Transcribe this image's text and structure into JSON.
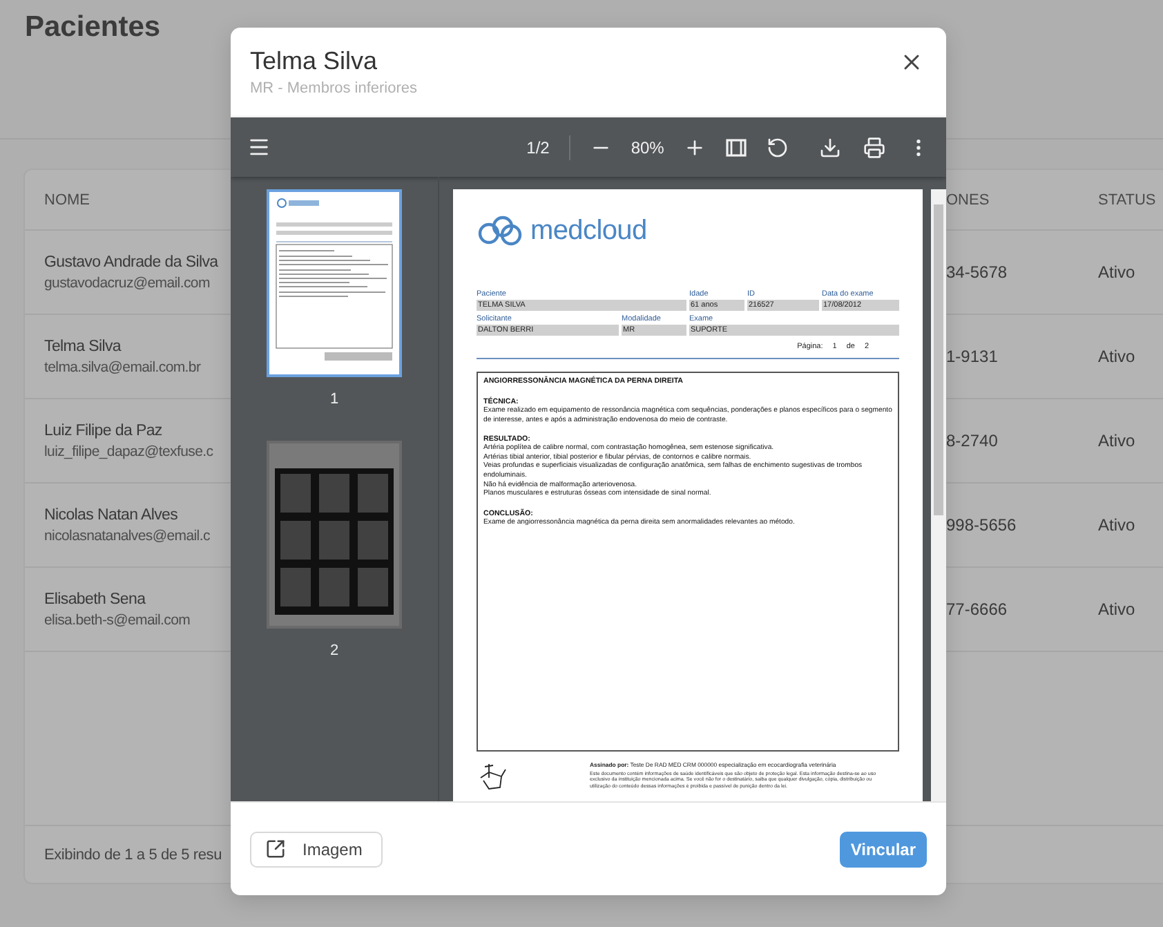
{
  "page": {
    "title": "Pacientes"
  },
  "table": {
    "columns": [
      "NOME",
      "ONES",
      "STATUS"
    ],
    "rows": [
      {
        "name": "Gustavo Andrade da Silva",
        "email": "gustavodacruz@email.com",
        "phone": "34-5678",
        "status": "Ativo"
      },
      {
        "name": "Telma Silva",
        "email": "telma.silva@email.com.br",
        "phone": "1-9131",
        "status": "Ativo"
      },
      {
        "name": "Luiz Filipe da Paz",
        "email": "luiz_filipe_dapaz@texfuse.c",
        "phone": "8-2740",
        "status": "Ativo"
      },
      {
        "name": "Nicolas Natan Alves",
        "email": "nicolasnatanalves@email.c",
        "phone": "998-5656",
        "status": "Ativo"
      },
      {
        "name": "Elisabeth Sena",
        "email": "elisa.beth-s@email.com",
        "phone": "77-6666",
        "status": "Ativo"
      }
    ],
    "footer": "Exibindo de 1 a 5 de 5 resu"
  },
  "modal": {
    "title": "Telma Silva",
    "subtitle": "MR - Membros inferiores",
    "viewer": {
      "page_indicator": "1/2",
      "zoom": "80%",
      "thumbnails": [
        {
          "label": "1",
          "kind": "report",
          "selected": true
        },
        {
          "label": "2",
          "kind": "images",
          "selected": false
        }
      ],
      "document": {
        "logo": "medcloud",
        "field_rows": [
          [
            {
              "label": "Paciente",
              "value": "TELMA SILVA"
            },
            {
              "label": "Idade",
              "value": "61 anos"
            },
            {
              "label": "ID",
              "value": "216527"
            },
            {
              "label": "Data do exame",
              "value": "17/08/2012"
            }
          ],
          [
            {
              "label": "Solicitante",
              "value": "DALTON BERRI"
            },
            {
              "label": "Modalidade",
              "value": "MR"
            },
            {
              "label": "Exame",
              "value": "SUPORTE"
            }
          ]
        ],
        "page_label": "Página:",
        "page_number": "1",
        "page_of": "de",
        "page_total": "2",
        "report_title": "ANGIORRESSONÂNCIA MAGNÉTICA DA PERNA DIREITA",
        "sections": [
          {
            "heading": "TÉCNICA:",
            "lines": [
              "Exame realizado em equipamento de ressonância magnética com sequências, ponderações e planos específicos para o segmento de interesse, antes e após a administração endovenosa do meio de contraste."
            ]
          },
          {
            "heading": "RESULTADO:",
            "lines": [
              "Artéria poplítea de calibre normal, com contrastação homogênea, sem estenose significativa.",
              "Artérias tibial anterior, tibial posterior e fibular pérvias, de contornos e calibre normais.",
              "Veias profundas e superficiais visualizadas de configuração anatômica, sem falhas de enchimento sugestivas de trombos endoluminais.",
              "Não há evidência de malformação arteriovenosa.",
              "Planos musculares e estruturas ósseas com intensidade de sinal normal."
            ]
          },
          {
            "heading": "CONCLUSÃO:",
            "lines": [
              "Exame de angiorressonância magnética da perna direita sem anormalidades relevantes ao método."
            ]
          }
        ],
        "signed_by": "**Assinado por:** Teste De RAD MED CRM 000000 especialização em ecocardiografia veterinária",
        "disclaimer": "Este documento contém informações de saúde identificáveis que são objeto de proteção legal. Esta informação destina-se ao uso exclusivo da instituição mencionada acima. Se você não for o destinatário, saiba que qualquer divulgação, cópia, distribuição ou utilização do conteúdo dessas informações é proibida e passível de punição dentro da lei."
      }
    },
    "buttons": [
      {
        "label": "Imagem",
        "kind": "secondary"
      },
      {
        "label": "Vincular",
        "kind": "primary"
      }
    ]
  }
}
